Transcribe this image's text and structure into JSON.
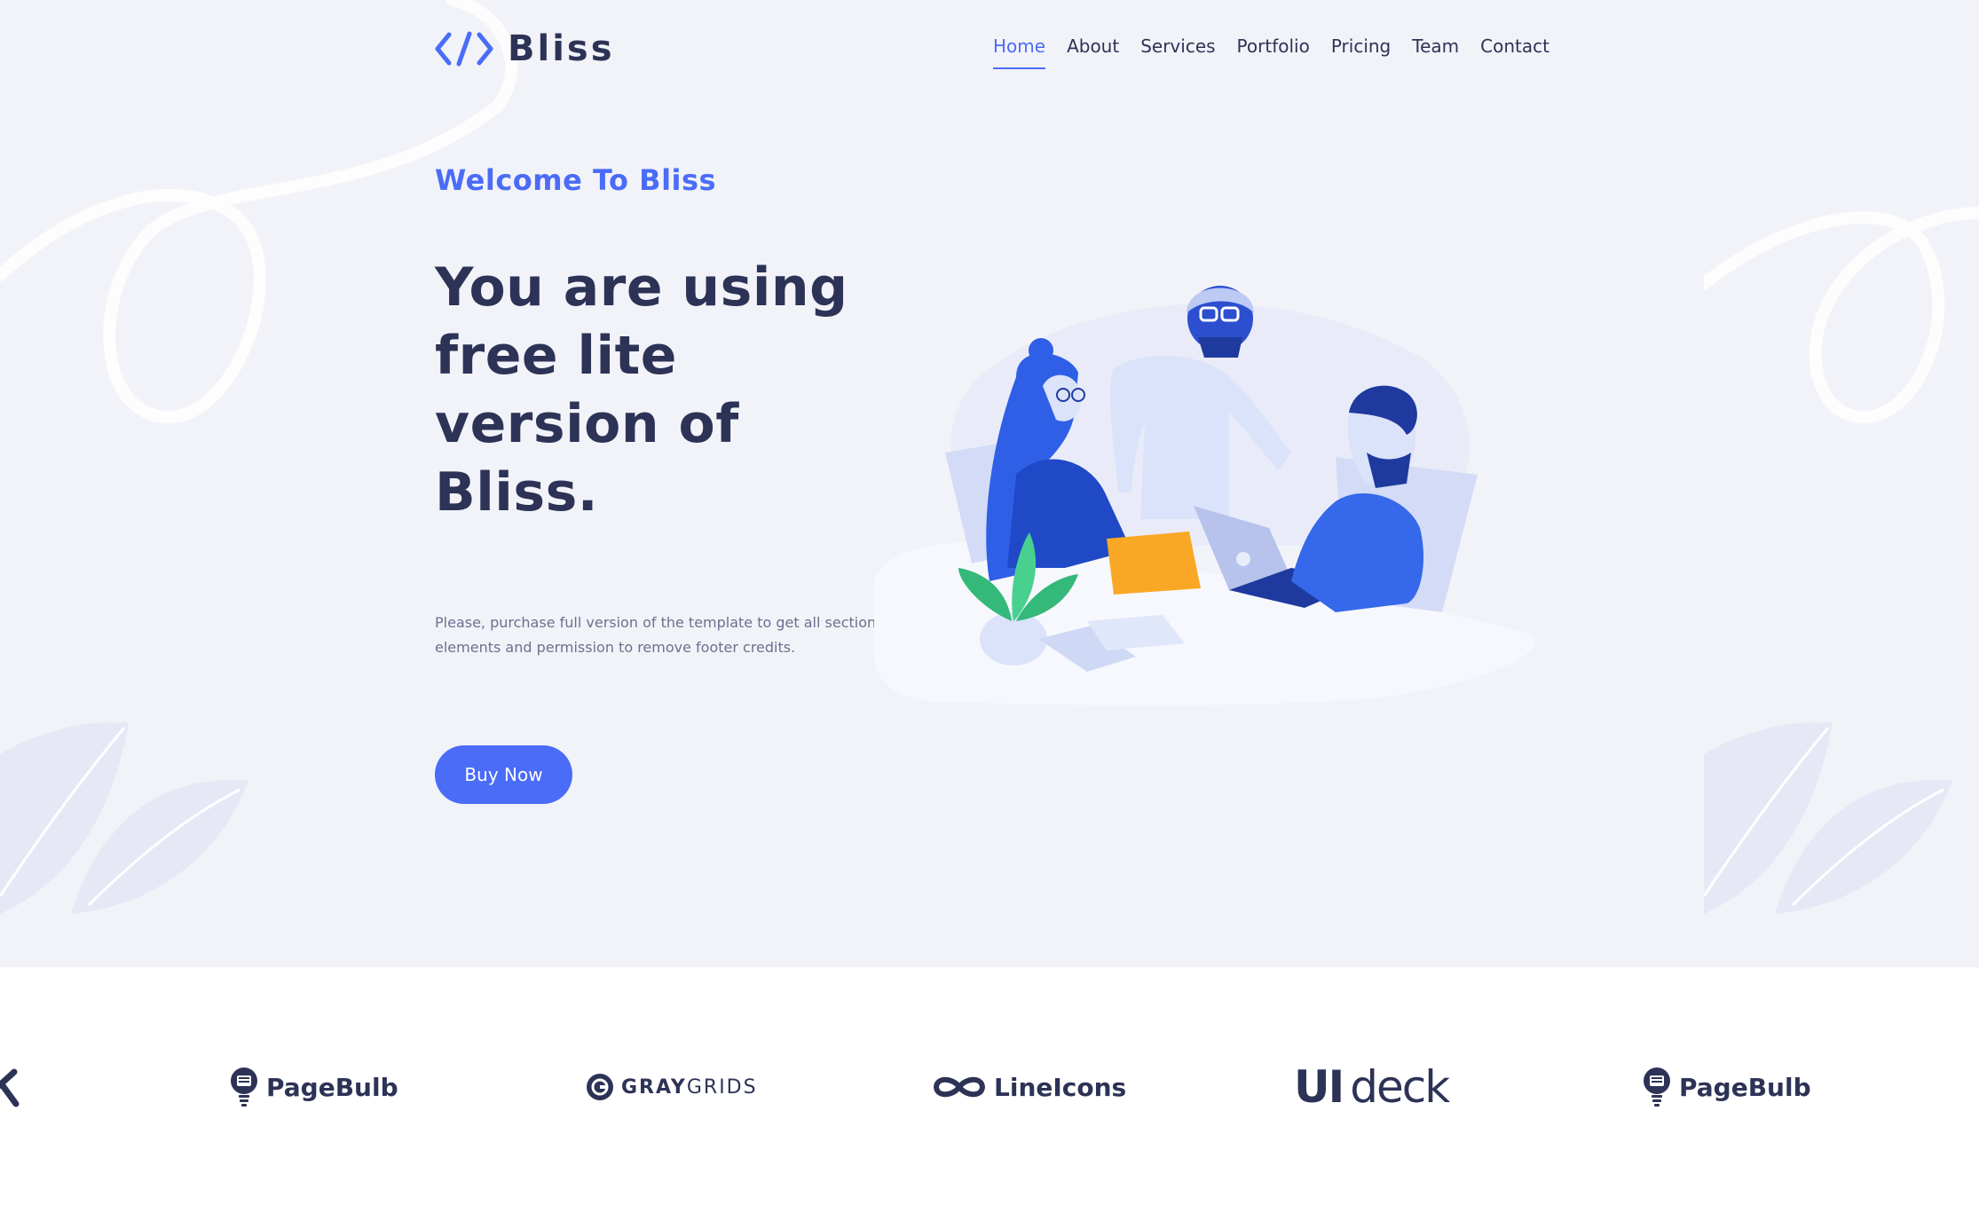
{
  "brand": {
    "name": "Bliss",
    "accent_color": "#4a6cf7",
    "dark_color": "#2d3356",
    "logo_icon": "code-brackets-icon"
  },
  "nav": {
    "items": [
      {
        "label": "Home",
        "active": true
      },
      {
        "label": "About"
      },
      {
        "label": "Services"
      },
      {
        "label": "Portfolio"
      },
      {
        "label": "Pricing"
      },
      {
        "label": "Team"
      },
      {
        "label": "Contact"
      }
    ]
  },
  "hero": {
    "welcome": "Welcome To Bliss",
    "headline": "You are using free lite version of Bliss.",
    "description": "Please, purchase full version of the template to get all sections, elements and permission to remove footer credits.",
    "button_label": "Buy Now"
  },
  "brands": {
    "items": [
      {
        "name": "PageBulb",
        "icon": "lightbulb-icon"
      },
      {
        "name_a": "GRAY",
        "name_b": "GRIDS",
        "icon": "graygrids-icon"
      },
      {
        "name": "LineIcons",
        "icon": "infinity-icon"
      },
      {
        "name": "deck",
        "prefix": "UI"
      },
      {
        "name": "PageBulb",
        "icon": "lightbulb-icon"
      }
    ]
  }
}
